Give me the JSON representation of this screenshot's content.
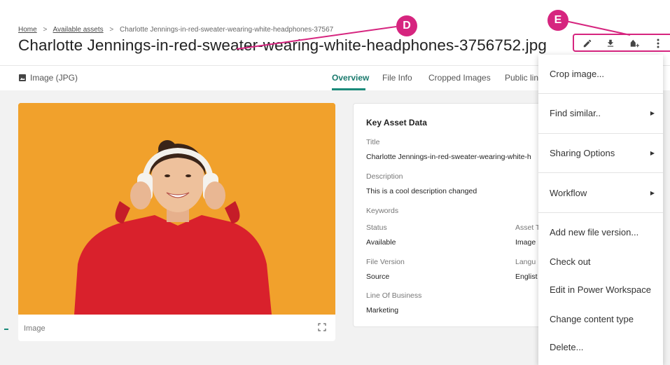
{
  "breadcrumb": {
    "home": "Home",
    "available_assets": "Available assets",
    "current": "Charlotte Jennings-in-red-sweater-wearing-white-headphones-37567",
    "sep1": ">",
    "sep2": ">"
  },
  "page_title": "Charlotte Jennings-in-red-sweater-wearing-white-headphones-3756752.jpg",
  "toolbar": {
    "icons": [
      "edit-icon",
      "download-icon",
      "add-to-collection-icon",
      "more-vert-icon"
    ]
  },
  "file_type": "Image (JPG)",
  "tabs": [
    {
      "label": "Overview"
    },
    {
      "label": "File Info"
    },
    {
      "label": "Cropped Images"
    },
    {
      "label": "Public lin"
    }
  ],
  "image_card": {
    "caption": "Image"
  },
  "key_data": {
    "heading": "Key Asset Data",
    "title_label": "Title",
    "title_value": "Charlotte Jennings-in-red-sweater-wearing-white-h",
    "description_label": "Description",
    "description_value": "This is a cool description changed",
    "keywords_label": "Keywords",
    "status_label": "Status",
    "status_value": "Available",
    "asset_type_label": "Asset T",
    "asset_type_value": "Image",
    "file_version_label": "File Version",
    "file_version_value": "Source",
    "language_label": "Langu",
    "language_value": "Englist",
    "lob_label": "Line Of Business",
    "lob_value": "Marketing"
  },
  "menu": {
    "items": [
      {
        "label": "Crop image...",
        "submenu": false
      },
      {
        "label": "Find similar..",
        "submenu": true
      },
      {
        "label": "Sharing Options",
        "submenu": true
      },
      {
        "label": "Workflow",
        "submenu": true
      },
      {
        "label": "Add new file version...",
        "submenu": false
      },
      {
        "label": "Check out",
        "submenu": false
      },
      {
        "label": "Edit in Power Workspace",
        "submenu": false
      },
      {
        "label": "Change content type",
        "submenu": false
      },
      {
        "label": "Delete...",
        "submenu": false
      }
    ],
    "submenu_arrow": "▶"
  },
  "callouts": {
    "d": "D",
    "e": "E"
  },
  "colors": {
    "accent_teal": "#1a7a6d",
    "callout_pink": "#d6257f",
    "image_bg_orange": "#f1a12c",
    "sweater_red": "#d9212c"
  }
}
